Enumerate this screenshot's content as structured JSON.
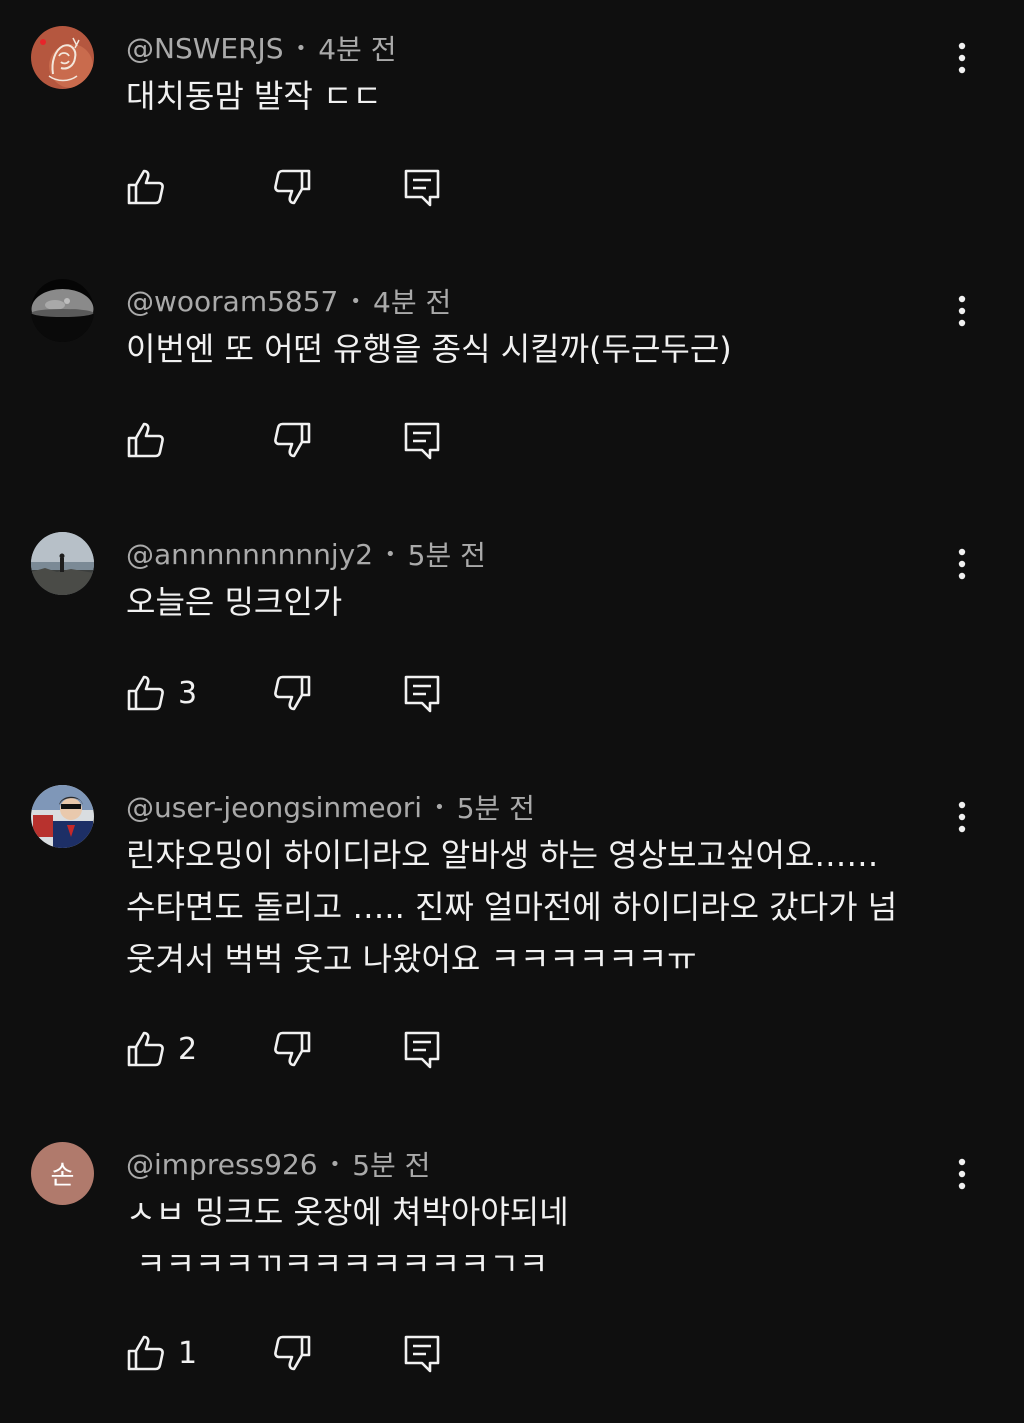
{
  "comments": [
    {
      "handle": "@NSWERJS",
      "time": "4분 전",
      "text": "대치동맘 발작 ㄷㄷ",
      "likes": "",
      "avatar_icon": "sketch-portrait-avatar"
    },
    {
      "handle": "@wooram5857",
      "time": "4분 전",
      "text": "이번엔 또 어떤 유행을 종식 시킬까(두근두근)",
      "likes": "",
      "avatar_icon": "moon-avatar"
    },
    {
      "handle": "@annnnnnnnnjy2",
      "time": "5분 전",
      "text": "오늘은 밍크인가",
      "likes": "3",
      "avatar_icon": "beach-photo-avatar"
    },
    {
      "handle": "@user-jeongsinmeori",
      "time": "5분 전",
      "text": "린쟈오밍이 하이디라오 알바생 하는 영상보고싶어요……\n수타면도 돌리고 ….. 진짜 얼마전에 하이디라오 갔다가 넘\n웃겨서 벅벅 웃고 나왔어요 ㅋㅋㅋㅋㅋㅋㅠ",
      "likes": "2",
      "avatar_icon": "person-photo-avatar"
    },
    {
      "handle": "@impress926",
      "time": "5분 전",
      "text": "ㅅㅂ 밍크도 옷장에 쳐박아야되네\n ㅋㅋㅋㅋㄲㅋㅋㅋㅋㅋㅋㅋㄱㅋ",
      "likes": "1",
      "avatar_letter": "손",
      "avatar_color": "#b07a6c"
    }
  ],
  "colors": {
    "background": "#0f0f0f",
    "primary_text": "#f1f1f1",
    "secondary_text": "#aaaaaa"
  }
}
